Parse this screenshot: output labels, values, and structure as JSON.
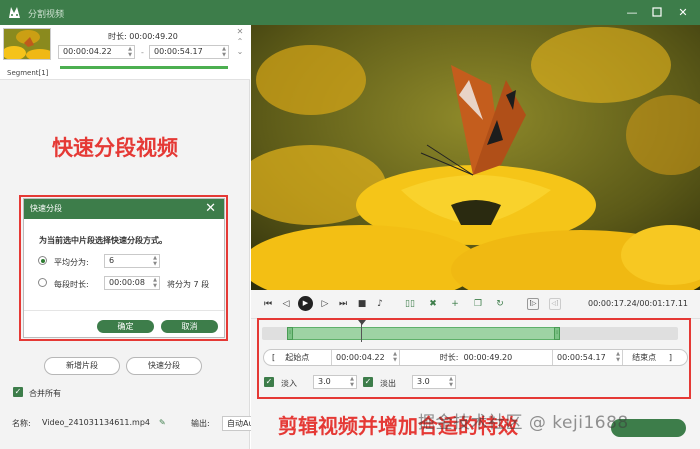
{
  "app": {
    "title": "分割视频"
  },
  "segment": {
    "label": "Segment[1]",
    "duration_text": "时长:  00:00:49.20",
    "start": "00:00:04.22",
    "end": "00:00:54.17"
  },
  "annotations": {
    "left": "快速分段视频",
    "bottom": "剪辑视频并增加合适的特效"
  },
  "dialog": {
    "title": "快速分段",
    "prompt": "为当前选中片段选择快速分段方式。",
    "option_equal_label": "平均分为:",
    "option_equal_value": "6",
    "option_each_label": "每段时长:",
    "option_each_value": "00:00:08",
    "option_each_hint": "将分为 7 段",
    "ok": "确定",
    "cancel": "取消",
    "selected_option": "equal"
  },
  "left_actions": {
    "new_segment": "新增片段",
    "quick_split": "快速分段",
    "merge_all": "合并所有",
    "merge_all_checked": true
  },
  "bottom": {
    "name_label": "名称:",
    "name_value": "Video_241031134611.mp4",
    "output_label": "输出:",
    "output_value": "自动Auto",
    "watermark": "掘金技术社区 @ keji1688"
  },
  "player": {
    "time": "00:00:17.24/00:01:17.11"
  },
  "range": {
    "start_label": "起始点",
    "start_value": "00:00:04.22",
    "duration_label": "时长:",
    "duration_value": "00:00:49.20",
    "end_value": "00:00:54.17",
    "end_label": "结束点"
  },
  "fade": {
    "fade_in_label": "淡入",
    "fade_in_value": "3.0",
    "fade_in_checked": true,
    "fade_out_label": "淡出",
    "fade_out_value": "3.0",
    "fade_out_checked": true
  },
  "colors": {
    "brand_green": "#3d7d4a",
    "annotation_red": "#e53935"
  }
}
